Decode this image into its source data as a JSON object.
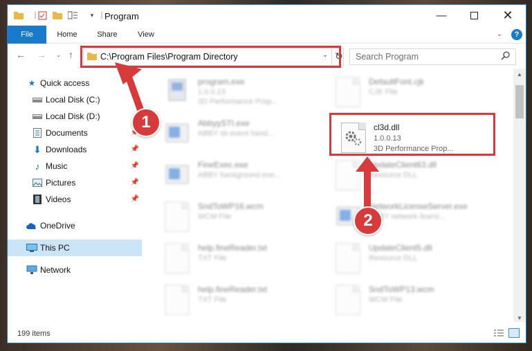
{
  "window": {
    "title": "Program",
    "path": "C:\\Program Files\\Program Directory"
  },
  "ribbon": {
    "tabs": [
      "File",
      "Home",
      "Share",
      "View"
    ]
  },
  "search": {
    "placeholder": "Search Program"
  },
  "sidebar": {
    "items": [
      {
        "label": "Quick access",
        "icon": "star-icon",
        "pinned": false
      },
      {
        "label": "Local Disk (C:)",
        "icon": "drive-icon",
        "pinned": false
      },
      {
        "label": "Local Disk (D:)",
        "icon": "drive-icon",
        "pinned": false
      },
      {
        "label": "Documents",
        "icon": "documents-icon",
        "pinned": true
      },
      {
        "label": "Downloads",
        "icon": "downloads-icon",
        "pinned": true
      },
      {
        "label": "Music",
        "icon": "music-icon",
        "pinned": true
      },
      {
        "label": "Pictures",
        "icon": "pictures-icon",
        "pinned": true
      },
      {
        "label": "Videos",
        "icon": "videos-icon",
        "pinned": true
      },
      {
        "label": "OneDrive",
        "icon": "cloud-icon",
        "pinned": false
      },
      {
        "label": "This PC",
        "icon": "pc-icon",
        "pinned": false,
        "selected": true
      },
      {
        "label": "Network",
        "icon": "network-icon",
        "pinned": false
      }
    ]
  },
  "files": [
    {
      "name": "program.exe",
      "line2": "1.0.0.13",
      "line3": "3D Performance Prop..."
    },
    {
      "name": "DefaultFont.cjk",
      "line2": "CJK File",
      "line3": ""
    },
    {
      "name": "AbbyySTI.exe",
      "line2": "ABBY sti event hand...",
      "line3": ""
    },
    {
      "name": "cl3d.dll",
      "line2": "1.0.0.13",
      "line3": "3D Performance Prop..."
    },
    {
      "name": "FineExec.exe",
      "line2": "ABBY background exe...",
      "line3": ""
    },
    {
      "name": "UpdateClient63.dll",
      "line2": "Resource DLL",
      "line3": ""
    },
    {
      "name": "SndToWP16.wcm",
      "line2": "WCM File",
      "line3": ""
    },
    {
      "name": "NetworkLicenseServer.exe",
      "line2": "ABBY network licens...",
      "line3": ""
    },
    {
      "name": "help.fineReader.txt",
      "line2": "TXT File",
      "line3": ""
    },
    {
      "name": "UpdateClient5.dll",
      "line2": "Resource DLL",
      "line3": ""
    },
    {
      "name": "help.fineReader.txt",
      "line2": "TXT File",
      "line3": ""
    },
    {
      "name": "SndToWP13.wcm",
      "line2": "WCM File",
      "line3": ""
    }
  ],
  "status": {
    "item_count": "199 items"
  },
  "annotations": {
    "step1": "1",
    "step2": "2",
    "color": "#d63a3a"
  }
}
